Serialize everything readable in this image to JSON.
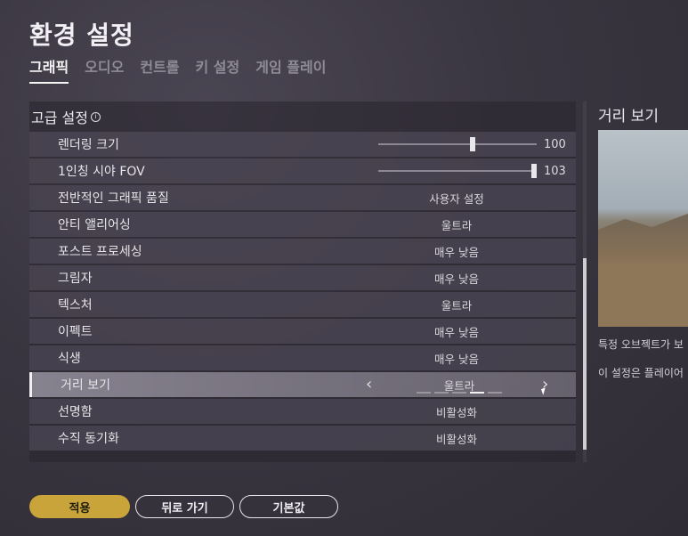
{
  "header": {
    "title": "환경 설정"
  },
  "tabs": [
    {
      "label": "그래픽",
      "active": true
    },
    {
      "label": "오디오",
      "active": false
    },
    {
      "label": "컨트롤",
      "active": false
    },
    {
      "label": "키 설정",
      "active": false
    },
    {
      "label": "게임 플레이",
      "active": false
    }
  ],
  "panel": {
    "header": "고급 설정",
    "rows": [
      {
        "label": "렌더링 크기",
        "type": "slider",
        "value": "100",
        "fraction": 0.6
      },
      {
        "label": "1인칭 시야 FOV",
        "type": "slider",
        "value": "103",
        "fraction": 1.0
      },
      {
        "label": "전반적인 그래픽 품질",
        "value": "사용자 설정"
      },
      {
        "label": "안티 앨리어싱",
        "value": "울트라"
      },
      {
        "label": "포스트 프로세싱",
        "value": "매우 낮음"
      },
      {
        "label": "그림자",
        "value": "매우 낮음"
      },
      {
        "label": "텍스처",
        "value": "울트라"
      },
      {
        "label": "이펙트",
        "value": "매우 낮음"
      },
      {
        "label": "식생",
        "value": "매우 낮음"
      },
      {
        "label": "거리 보기",
        "value": "울트라",
        "selected": true
      },
      {
        "label": "선명함",
        "value": "비활성화"
      },
      {
        "label": "수직 동기화",
        "value": "비활성화"
      }
    ]
  },
  "side": {
    "title": "거리 보기",
    "desc1": "특정 오브젝트가 보",
    "desc2": "이 설정은 플레이어"
  },
  "buttons": {
    "apply": "적용",
    "back": "뒤로 가기",
    "default": "기본값"
  },
  "colors": {
    "accent": "#c9a43a"
  }
}
